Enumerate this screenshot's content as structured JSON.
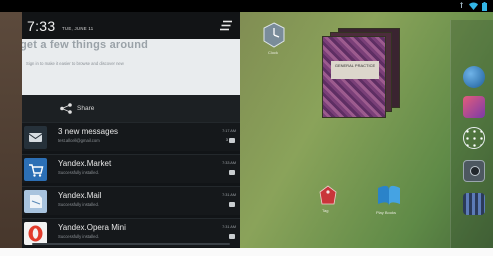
{
  "status_bar": {
    "icons": [
      "usb-icon",
      "wifi-icon",
      "battery-icon"
    ]
  },
  "shade": {
    "clock": "7:33",
    "date": "TUE, JUNE 11",
    "settings_icon": "settings-sliders-icon"
  },
  "expanded_notification": {
    "headline": "get a few things around",
    "subtext": "Sign in to make it easier to browse and discover new"
  },
  "actions": {
    "share_label": "Share",
    "share_icon": "share-icon"
  },
  "notifications": [
    {
      "title": "3 new messages",
      "subtitle": "test.allcell@gmail.com",
      "time": "7:17 AM",
      "count": "3",
      "icon": "mail-icon",
      "icon_color": "#26313a"
    },
    {
      "title": "Yandex.Market",
      "subtitle": "Successfully installed.",
      "time": "7:33 AM",
      "icon": "shopping-cart-icon",
      "icon_color": "#2c6fb5"
    },
    {
      "title": "Yandex.Mail",
      "subtitle": "Successfully installed.",
      "time": "7:31 AM",
      "icon": "envelope-icon",
      "icon_color": "#a8c3de"
    },
    {
      "title": "Yandex.Opera Mini",
      "subtitle": "Successfully installed.",
      "time": "7:31 AM",
      "icon": "opera-icon",
      "icon_color": "#e23b2b"
    }
  ],
  "home_screen": {
    "widget_book_title": "GENERAL PRACTICE",
    "home_icons": [
      {
        "label": "Clock",
        "icon": "clock-icon"
      },
      {
        "label": "Tag",
        "icon": "tag-icon"
      },
      {
        "label": "Play Books",
        "icon": "play-books-icon"
      }
    ],
    "dock_icons": [
      "globe-icon",
      "gallery-icon",
      "apps-grid-icon",
      "camera-icon",
      "video-icon"
    ]
  },
  "colors": {
    "shade_bg": "#111417",
    "accent_blue": "#2c6fb5",
    "opera_red": "#e23b2b"
  }
}
